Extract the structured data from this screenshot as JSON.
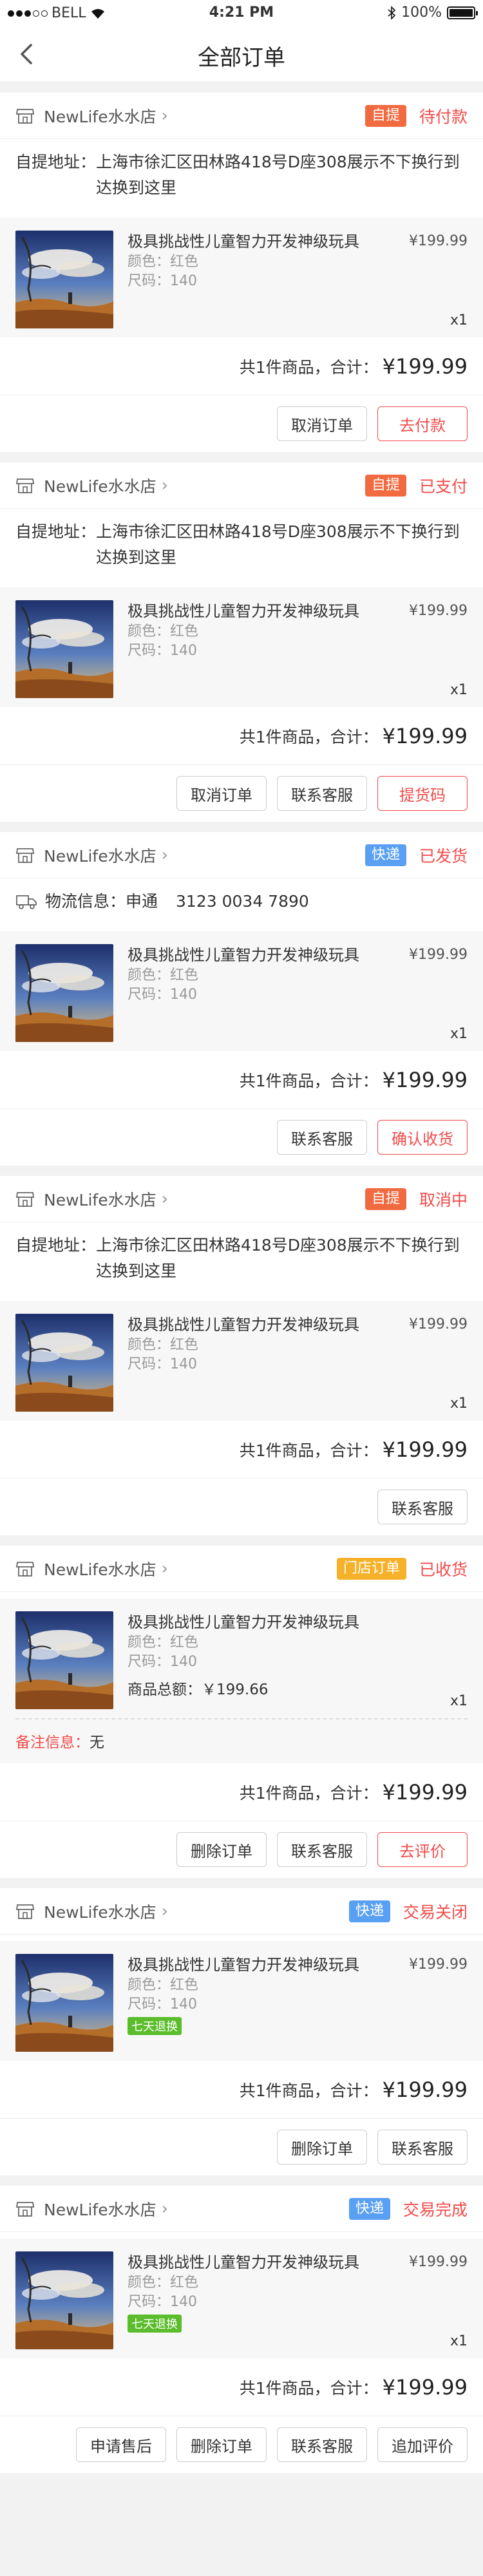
{
  "status_bar": {
    "carrier": "BELL",
    "time": "4:21 PM",
    "battery": "100%"
  },
  "nav": {
    "title": "全部订单"
  },
  "orders": [
    {
      "store": "NewLife水水店",
      "tag": "自提",
      "tag_type": "self",
      "status": "待付款",
      "address_label": "自提地址：",
      "address": "上海市徐汇区田林路418号D座308展示不下换行到达换到这里",
      "product": {
        "name": "极具挑战性儿童智力开发神级玩具",
        "price": "¥199.99",
        "color": "颜色：红色",
        "size": "尺码：140",
        "qty": "x1"
      },
      "summary": "共1件商品，合计：",
      "total": "¥199.99",
      "actions": [
        {
          "label": "取消订单",
          "primary": false
        },
        {
          "label": "去付款",
          "primary": true
        }
      ]
    },
    {
      "store": "NewLife水水店",
      "tag": "自提",
      "tag_type": "self",
      "status": "已支付",
      "address_label": "自提地址：",
      "address": "上海市徐汇区田林路418号D座308展示不下换行到达换到这里",
      "product": {
        "name": "极具挑战性儿童智力开发神级玩具",
        "price": "¥199.99",
        "color": "颜色：红色",
        "size": "尺码：140",
        "qty": "x1"
      },
      "summary": "共1件商品，合计：",
      "total": "¥199.99",
      "actions": [
        {
          "label": "取消订单",
          "primary": false
        },
        {
          "label": "联系客服",
          "primary": false
        },
        {
          "label": "提货码",
          "primary": true
        }
      ]
    },
    {
      "store": "NewLife水水店",
      "tag": "快递",
      "tag_type": "express",
      "status": "已发货",
      "logistics_label": "物流信息：",
      "logistics_company": "申通",
      "logistics_number": "3123 0034 7890",
      "product": {
        "name": "极具挑战性儿童智力开发神级玩具",
        "price": "¥199.99",
        "color": "颜色：红色",
        "size": "尺码：140",
        "qty": "x1"
      },
      "summary": "共1件商品，合计：",
      "total": "¥199.99",
      "actions": [
        {
          "label": "联系客服",
          "primary": false
        },
        {
          "label": "确认收货",
          "primary": true
        }
      ]
    },
    {
      "store": "NewLife水水店",
      "tag": "自提",
      "tag_type": "self",
      "status": "取消中",
      "address_label": "自提地址：",
      "address": "上海市徐汇区田林路418号D座308展示不下换行到达换到这里",
      "product": {
        "name": "极具挑战性儿童智力开发神级玩具",
        "price": "¥199.99",
        "color": "颜色：红色",
        "size": "尺码：140",
        "qty": "x1"
      },
      "summary": "共1件商品，合计：",
      "total": "¥199.99",
      "actions": [
        {
          "label": "联系客服",
          "primary": false
        }
      ]
    },
    {
      "store": "NewLife水水店",
      "tag": "门店订单",
      "tag_type": "store",
      "status": "已收货",
      "product": {
        "name": "极具挑战性儿童智力开发神级玩具",
        "price": "",
        "color": "颜色：红色",
        "size": "尺码：140",
        "qty": "x1",
        "goods_total": "商品总额：￥199.66"
      },
      "remark_label": "备注信息：",
      "remark": "无",
      "summary": "共1件商品，合计：",
      "total": "¥199.99",
      "actions": [
        {
          "label": "删除订单",
          "primary": false
        },
        {
          "label": "联系客服",
          "primary": false
        },
        {
          "label": "去评价",
          "primary": true
        }
      ]
    },
    {
      "store": "NewLife水水店",
      "tag": "快递",
      "tag_type": "express",
      "status": "交易关闭",
      "product": {
        "name": "极具挑战性儿童智力开发神级玩具",
        "price": "¥199.99",
        "color": "颜色：红色",
        "size": "尺码：140",
        "qty": "",
        "badge": "七天退换"
      },
      "summary": "共1件商品，合计：",
      "total": "¥199.99",
      "actions": [
        {
          "label": "删除订单",
          "primary": false
        },
        {
          "label": "联系客服",
          "primary": false
        }
      ]
    },
    {
      "store": "NewLife水水店",
      "tag": "快递",
      "tag_type": "express",
      "status": "交易完成",
      "product": {
        "name": "极具挑战性儿童智力开发神级玩具",
        "price": "¥199.99",
        "color": "颜色：红色",
        "size": "尺码：140",
        "qty": "x1",
        "badge": "七天退换"
      },
      "summary": "共1件商品，合计：",
      "total": "¥199.99",
      "actions": [
        {
          "label": "申请售后",
          "primary": false
        },
        {
          "label": "删除订单",
          "primary": false
        },
        {
          "label": "联系客服",
          "primary": false
        },
        {
          "label": "追加评价",
          "primary": false
        }
      ]
    }
  ]
}
